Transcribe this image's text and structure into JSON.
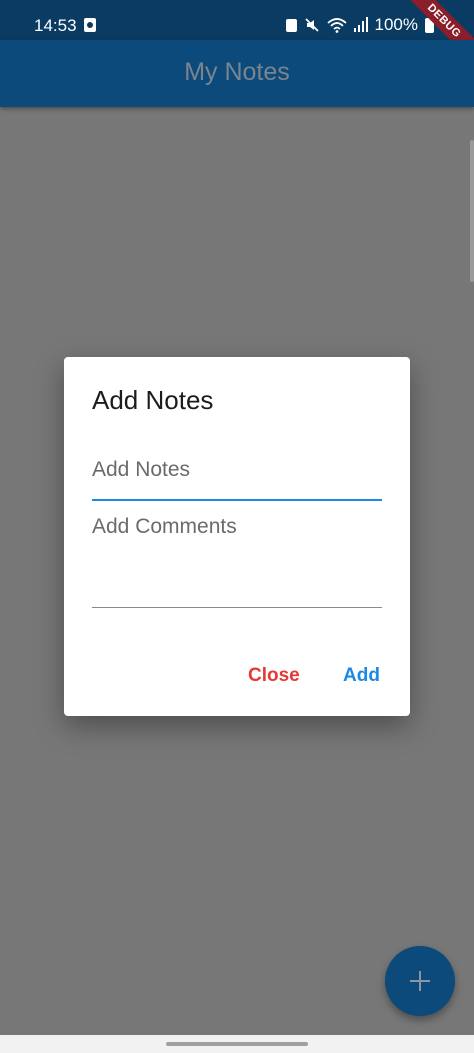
{
  "status_bar": {
    "time": "14:53",
    "battery": "100%",
    "icons": [
      "camera-icon",
      "camera-icon",
      "mute-icon",
      "wifi-icon",
      "signal-icon",
      "battery-icon"
    ]
  },
  "debug_banner": "DEBUG",
  "app_bar": {
    "title": "My Notes"
  },
  "dialog": {
    "title": "Add Notes",
    "notes_placeholder": "Add Notes",
    "comments_placeholder": "Add Comments",
    "close_label": "Close",
    "add_label": "Add"
  },
  "fab": {
    "icon": "plus-icon"
  },
  "colors": {
    "app_bar": "#0b4a7a",
    "status_bar": "#0a3b63",
    "scrim": "#777777",
    "close": "#e53935",
    "add": "#1e88e5",
    "focus_underline": "#1e88e5"
  }
}
